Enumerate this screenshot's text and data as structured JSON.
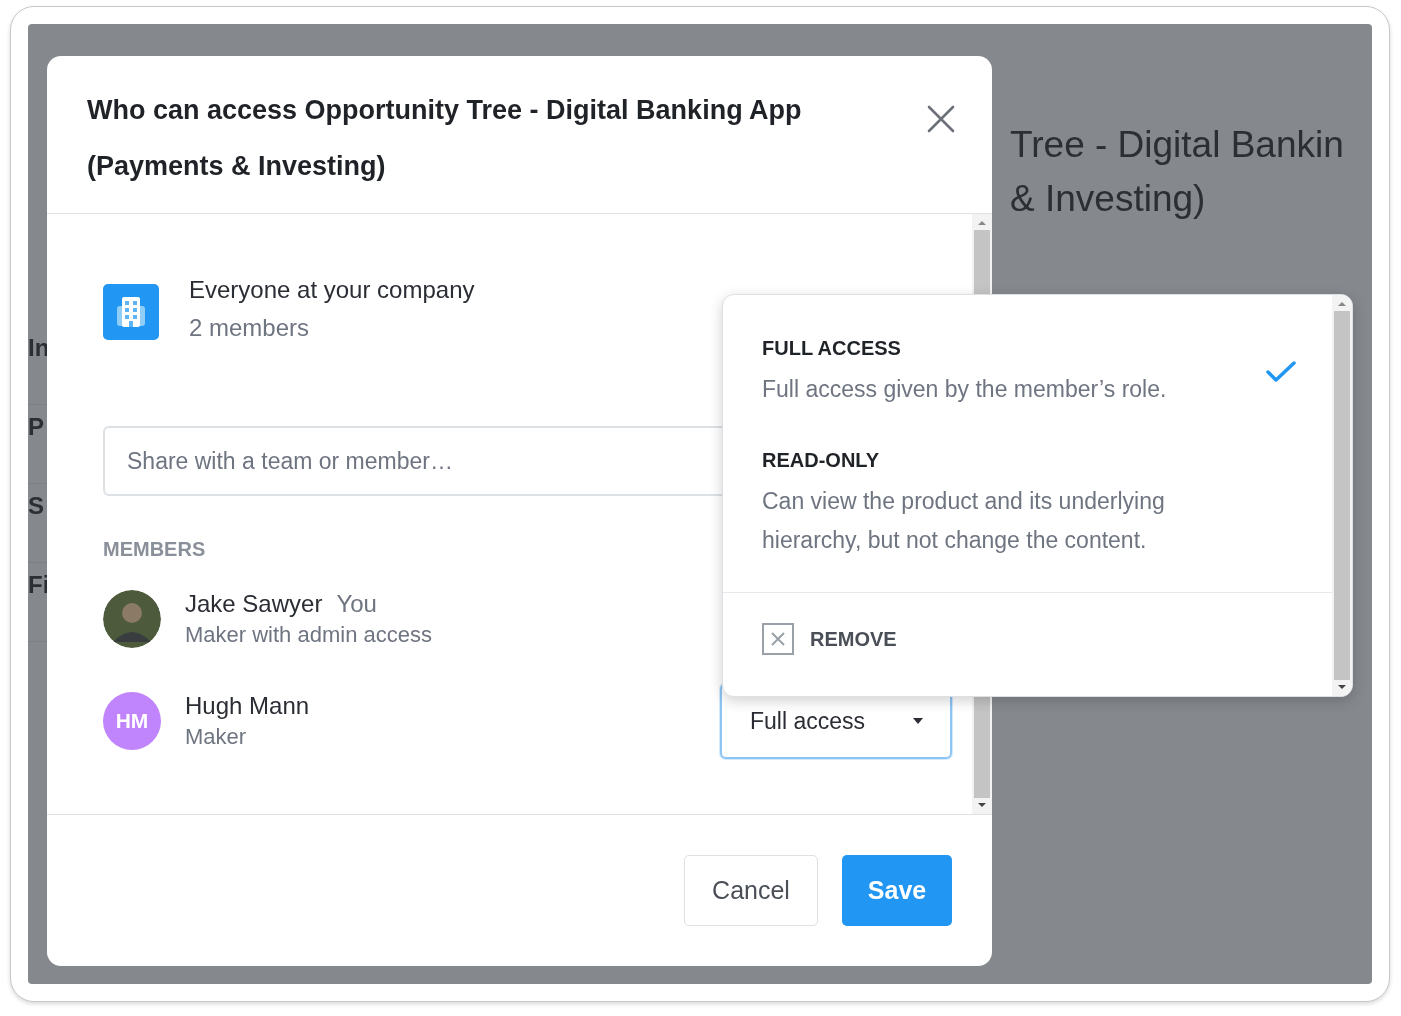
{
  "background": {
    "title_lines": [
      "Tree - Digital Bankin",
      "& Investing)"
    ],
    "side_labels": [
      "In",
      "P",
      "S",
      "Fi"
    ]
  },
  "dialog": {
    "title": "Who can access Opportunity Tree - Digital Banking App (Payments & Investing)",
    "company": {
      "name": "Everyone at your company",
      "count": "2 members"
    },
    "share": {
      "placeholder": "Share with a team or member…"
    },
    "members_heading": "MEMBERS",
    "members": [
      {
        "kind": "photo",
        "name": "Jake Sawyer",
        "tag": "You",
        "role": "Maker with admin access"
      },
      {
        "kind": "initials",
        "initials": "HM",
        "name": "Hugh Mann",
        "role": "Maker",
        "access": "Full access"
      }
    ],
    "buttons": [
      {
        "kind": "secondary",
        "label": "Cancel"
      },
      {
        "kind": "primary",
        "label": "Save"
      }
    ]
  },
  "access_menu": {
    "options": [
      {
        "label": "FULL ACCESS",
        "description": "Full access given by the member’s role.",
        "selected": true
      },
      {
        "label": "READ-ONLY",
        "description": "Can view the product and its underlying hierarchy, but not change the content.",
        "selected": false
      }
    ],
    "remove": "REMOVE"
  }
}
